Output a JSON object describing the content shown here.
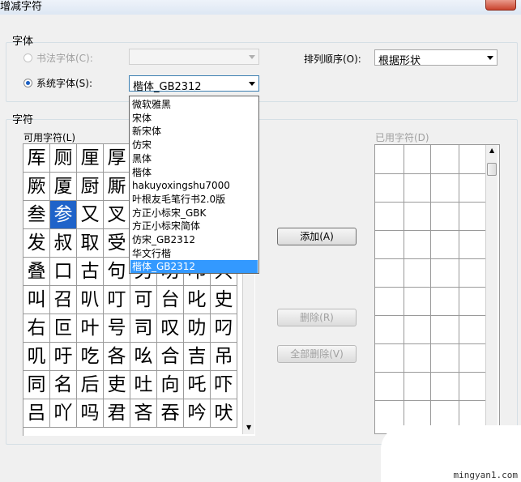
{
  "window": {
    "title": "增减字符"
  },
  "font_group": {
    "label": "字体",
    "calligraphy_radio": {
      "label": "书法字体(C):",
      "selected": false,
      "enabled": false
    },
    "calligraphy_combo": {
      "value": "",
      "enabled": false
    },
    "system_radio": {
      "label": "系统字体(S):",
      "selected": true
    },
    "system_combo": {
      "value": "楷体_GB2312",
      "expanded": true,
      "options": [
        "微软雅黑",
        "宋体",
        "新宋体",
        "仿宋",
        "黑体",
        "楷体",
        "hakuyoxingshu7000",
        "叶根友毛笔行书2.0版",
        "方正小标宋_GBK",
        "方正小标宋简体",
        "仿宋_GB2312",
        "华文行楷",
        "楷体_GB2312"
      ],
      "selected_option": "楷体_GB2312"
    },
    "sort_label": "排列顺序(O):",
    "sort_combo": {
      "value": "根据形状"
    }
  },
  "char_group": {
    "label": "字符",
    "available_label": "可用字符(L)",
    "used_label": "已用字符(D)",
    "available_rows": [
      [
        "厍",
        "厕",
        "厘",
        "厚",
        "",
        "",
        "",
        ""
      ],
      [
        "厥",
        "厦",
        "厨",
        "厮",
        "",
        "",
        "",
        ""
      ],
      [
        "叁",
        "参",
        "又",
        "叉",
        "",
        "",
        "",
        ""
      ],
      [
        "发",
        "叔",
        "取",
        "受",
        "",
        "",
        "",
        ""
      ],
      [
        "叠",
        "口",
        "古",
        "句",
        "另",
        "叨",
        "叩",
        "只"
      ],
      [
        "叫",
        "召",
        "叭",
        "叮",
        "可",
        "台",
        "叱",
        "史"
      ],
      [
        "右",
        "叵",
        "叶",
        "号",
        "司",
        "叹",
        "叻",
        "叼"
      ],
      [
        "叽",
        "吁",
        "吃",
        "各",
        "吆",
        "合",
        "吉",
        "吊"
      ],
      [
        "同",
        "名",
        "后",
        "吏",
        "吐",
        "向",
        "吒",
        "吓"
      ],
      [
        "吕",
        "吖",
        "吗",
        "君",
        "吝",
        "吞",
        "吟",
        "吠"
      ]
    ],
    "selected_char": "参",
    "add_button": "添加(A)",
    "delete_button": "删除(R)",
    "delete_all_button": "全部删除(V)"
  },
  "watermark": "mingyan1.com"
}
